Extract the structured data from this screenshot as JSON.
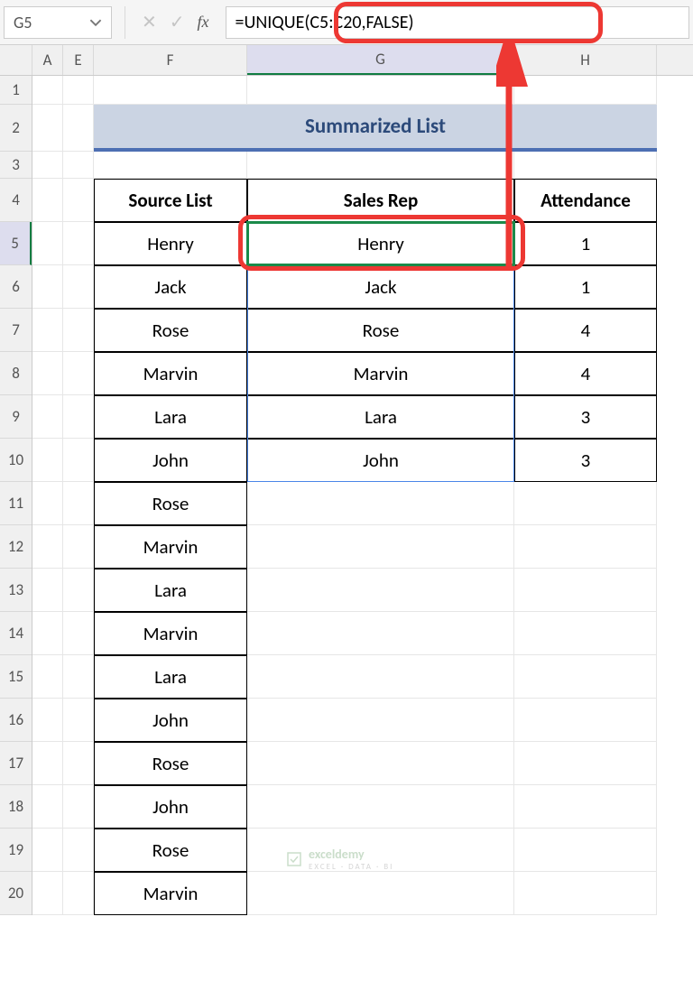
{
  "name_box": "G5",
  "fx_label": "fx",
  "formula": "=UNIQUE(C5:C20,FALSE)",
  "column_headers": {
    "A": "A",
    "E": "E",
    "F": "F",
    "G": "G",
    "H": "H"
  },
  "row_numbers": [
    "1",
    "2",
    "3",
    "4",
    "5",
    "6",
    "7",
    "8",
    "9",
    "10",
    "11",
    "12",
    "13",
    "14",
    "15",
    "16",
    "17",
    "18",
    "19",
    "20"
  ],
  "title": "Summarized List",
  "headers": {
    "F": "Source List",
    "G": "Sales Rep",
    "H": "Attendance"
  },
  "source": [
    "Henry",
    "Jack",
    "Rose",
    "Marvin",
    "Lara",
    "John",
    "Rose",
    "Marvin",
    "Lara",
    "Marvin",
    "Lara",
    "John",
    "Rose",
    "John",
    "Rose",
    "Marvin"
  ],
  "sales": [
    "Henry",
    "Jack",
    "Rose",
    "Marvin",
    "Lara",
    "John"
  ],
  "attendance": [
    "1",
    "1",
    "4",
    "4",
    "3",
    "3"
  ],
  "watermark": {
    "brand": "exceldemy",
    "tag": "EXCEL · DATA · BI"
  }
}
